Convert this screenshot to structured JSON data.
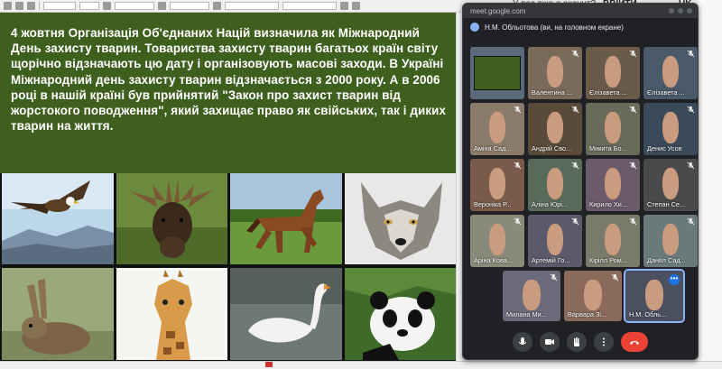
{
  "top_bar": {
    "left_text": "У вас вже є акаунт?",
    "button1": "ВВІЙТИ",
    "button2": "UK"
  },
  "slide": {
    "text": "4 жовтня Організація Об'єднаних Націй визначила як Міжнародний День захисту тварин. Товариства захисту тварин багатьох країн світу щорічно відзначають цю дату і організовують масові заходи. В Україні Міжнародний день захисту тварин відзначається з 2000 року. А в 2006 році в нашій країні був прийнятий \"Закон про захист тварин від жорстокого поводження\", який захищає право як свійських, так і диких тварин на життя.",
    "images": [
      "eagle",
      "moose",
      "horse",
      "wolf",
      "rabbit",
      "giraffe",
      "swan",
      "panda"
    ]
  },
  "meet": {
    "url": "meet.google.com",
    "presenting": "Н.М. Обльотова (ви, на головном екране)",
    "participants": [
      {
        "name": "",
        "screen": true
      },
      {
        "name": "Валентина ..."
      },
      {
        "name": "Єлізавета ..."
      },
      {
        "name": "Єлізавета ..."
      },
      {
        "name": "Аміна Сад..."
      },
      {
        "name": "Андрій Сво..."
      },
      {
        "name": "Микита Бо..."
      },
      {
        "name": "Денис Усов"
      },
      {
        "name": "Вероніка Р..."
      },
      {
        "name": "Аліна Юрі..."
      },
      {
        "name": "Кирило Хи..."
      },
      {
        "name": "Степан Се..."
      },
      {
        "name": "Аріна Кова..."
      },
      {
        "name": "Артемій Го..."
      },
      {
        "name": "Кірілл Ром..."
      },
      {
        "name": "Даніїл Сад..."
      }
    ],
    "bottom_row": [
      {
        "name": "Милана Ми..."
      },
      {
        "name": "Варвара Зі..."
      },
      {
        "name": "Н.М. Обль..."
      }
    ],
    "controls": [
      "mic-icon",
      "camera-icon",
      "hand-icon",
      "more-icon",
      "end-call-icon"
    ]
  },
  "colors": {
    "slide_bg": "#3f5f1f",
    "meet_bg": "#202124",
    "end_call": "#ea4335"
  }
}
